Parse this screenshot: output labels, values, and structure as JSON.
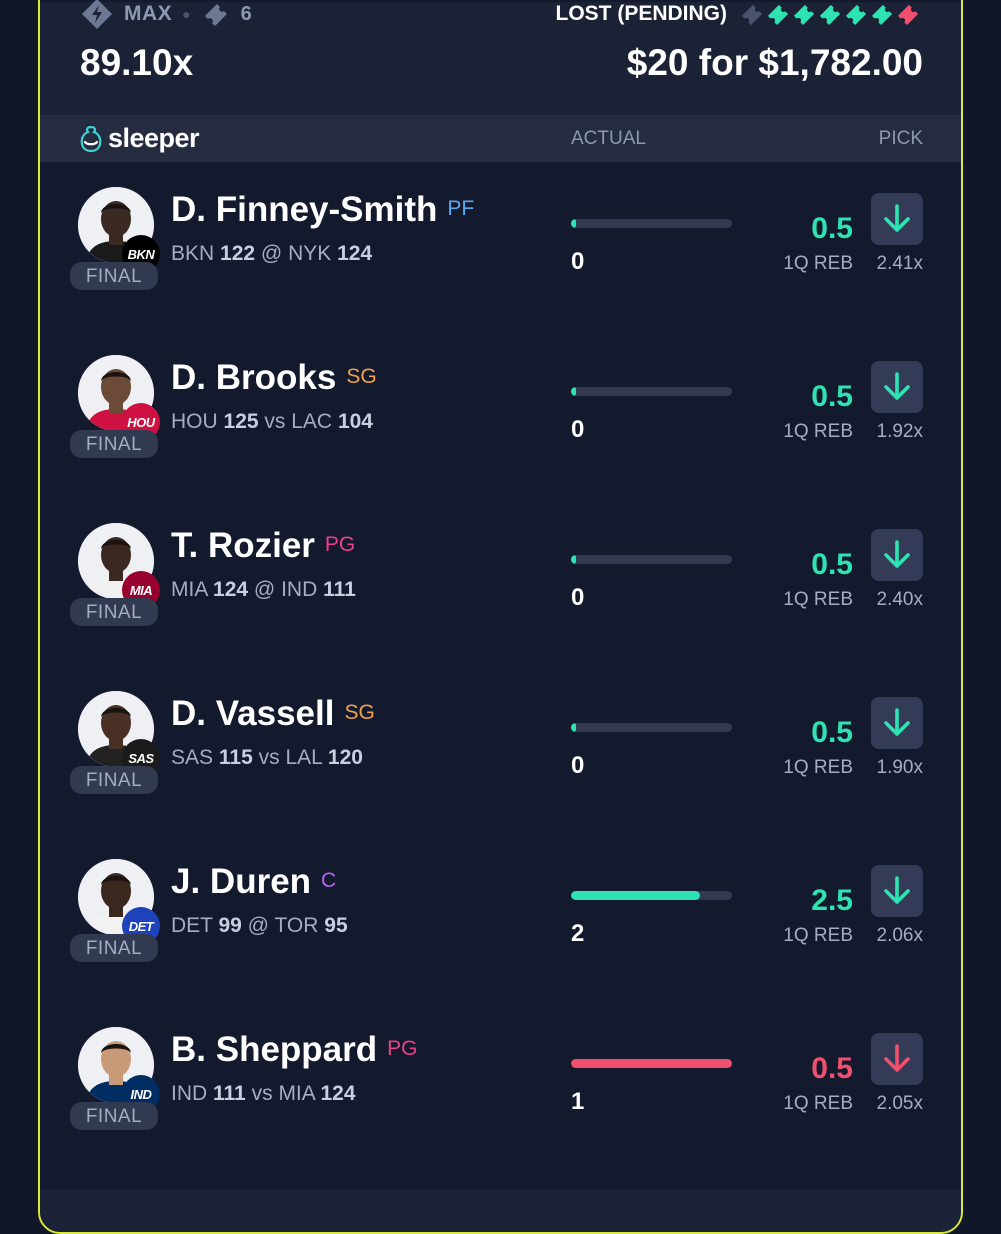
{
  "header": {
    "tier_label": "MAX",
    "pick_count": "6",
    "multiplier": "89.10x",
    "status": "LOST (PENDING)",
    "payout": "$20 for $1,782.00",
    "ticket_results": [
      "lost",
      "won",
      "won",
      "won",
      "won",
      "won",
      "lost"
    ]
  },
  "subheader": {
    "brand": "sleeper",
    "col_actual": "ACTUAL",
    "col_pick": "PICK"
  },
  "colors": {
    "accent_border": "#d9ea3b",
    "hit": "#2de3b2",
    "miss": "#f0506e",
    "pos_pf": "#5aa8f0",
    "pos_sg": "#f0a04b",
    "pos_pg": "#ec3f86",
    "pos_c": "#b563f2"
  },
  "players": [
    {
      "name": "D. Finney-Smith",
      "position": "PF",
      "pos_color": "#5aa8f0",
      "team_abbr": "BKN",
      "badge_color": "#000000",
      "team1": "BKN",
      "score1": "122",
      "sep": "@",
      "team2": "NYK",
      "score2": "124",
      "status": "FINAL",
      "actual": "0",
      "progress_pct": 3,
      "bar_color": "#2de3b2",
      "line": "0.5",
      "line_color": "#2de3b2",
      "stat": "1Q REB",
      "odds": "2.41x",
      "pick": "under",
      "pick_color": "#2de3b2",
      "avatar_tone": "#3a2a22",
      "jersey": "#1a1a1a"
    },
    {
      "name": "D. Brooks",
      "position": "SG",
      "pos_color": "#f0a04b",
      "team_abbr": "HOU",
      "badge_color": "#ce1141",
      "team1": "HOU",
      "score1": "125",
      "sep": "vs",
      "team2": "LAC",
      "score2": "104",
      "status": "FINAL",
      "actual": "0",
      "progress_pct": 3,
      "bar_color": "#2de3b2",
      "line": "0.5",
      "line_color": "#2de3b2",
      "stat": "1Q REB",
      "odds": "1.92x",
      "pick": "under",
      "pick_color": "#2de3b2",
      "avatar_tone": "#6b4a38",
      "jersey": "#ce1141"
    },
    {
      "name": "T. Rozier",
      "position": "PG",
      "pos_color": "#ec3f86",
      "team_abbr": "MIA",
      "badge_color": "#98002e",
      "team1": "MIA",
      "score1": "124",
      "sep": "@",
      "team2": "IND",
      "score2": "111",
      "status": "FINAL",
      "actual": "0",
      "progress_pct": 3,
      "bar_color": "#2de3b2",
      "line": "0.5",
      "line_color": "#2de3b2",
      "stat": "1Q REB",
      "odds": "2.40x",
      "pick": "under",
      "pick_color": "#2de3b2",
      "avatar_tone": "#3b2820",
      "jersey": "#f0f0f0"
    },
    {
      "name": "D. Vassell",
      "position": "SG",
      "pos_color": "#f0a04b",
      "team_abbr": "SAS",
      "badge_color": "#1b1b1b",
      "team1": "SAS",
      "score1": "115",
      "sep": "vs",
      "team2": "LAL",
      "score2": "120",
      "status": "FINAL",
      "actual": "0",
      "progress_pct": 3,
      "bar_color": "#2de3b2",
      "line": "0.5",
      "line_color": "#2de3b2",
      "stat": "1Q REB",
      "odds": "1.90x",
      "pick": "under",
      "pick_color": "#2de3b2",
      "avatar_tone": "#4a3024",
      "jersey": "#222222"
    },
    {
      "name": "J. Duren",
      "position": "C",
      "pos_color": "#b563f2",
      "team_abbr": "DET",
      "badge_color": "#1d42ba",
      "team1": "DET",
      "score1": "99",
      "sep": "@",
      "team2": "TOR",
      "score2": "95",
      "status": "FINAL",
      "actual": "2",
      "progress_pct": 80,
      "bar_color": "#2de3b2",
      "line": "2.5",
      "line_color": "#2de3b2",
      "stat": "1Q REB",
      "odds": "2.06x",
      "pick": "under",
      "pick_color": "#2de3b2",
      "avatar_tone": "#3a271e",
      "jersey": "#f2f2f2"
    },
    {
      "name": "B. Sheppard",
      "position": "PG",
      "pos_color": "#ec3f86",
      "team_abbr": "IND",
      "badge_color": "#002d62",
      "team1": "IND",
      "score1": "111",
      "sep": "vs",
      "team2": "MIA",
      "score2": "124",
      "status": "FINAL",
      "actual": "1",
      "progress_pct": 100,
      "bar_color": "#f0506e",
      "line": "0.5",
      "line_color": "#f0506e",
      "stat": "1Q REB",
      "odds": "2.05x",
      "pick": "under",
      "pick_color": "#f0506e",
      "avatar_tone": "#c99a78",
      "jersey": "#002d62"
    }
  ]
}
